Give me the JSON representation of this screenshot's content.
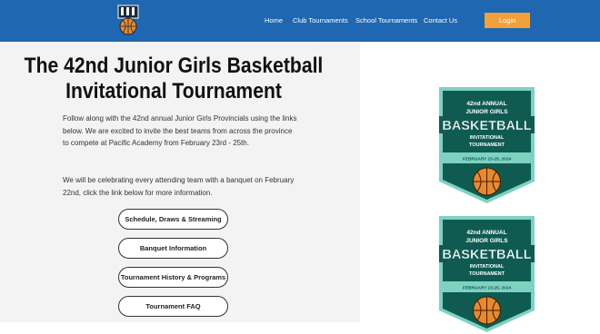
{
  "header": {
    "nav": [
      "Home",
      "Club Tournaments",
      "School Tournaments",
      "Contact Us"
    ],
    "login_label": "Login"
  },
  "main": {
    "title_line1": "The 42nd Junior Girls Basketball",
    "title_line2": "Invitational Tournament",
    "paragraph1": "Follow along with the 42nd annual Junior Girls Provincials using the links below. We are excited to invite the best teams from across the province to compete at Pacific Academy from February 23rd - 25th.",
    "paragraph2": "We will be celebrating every attending team with a banquet on February 22nd, click the link below for more information.",
    "buttons": [
      "Schedule, Draws & Streaming",
      "Banquet Information",
      "Tournament History & Programs",
      "Tournament FAQ"
    ]
  },
  "badge": {
    "line1": "42nd ANNUAL",
    "line2": "JUNIOR GIRLS",
    "line3": "BASKETBALL",
    "line4": "INVITATIONAL",
    "line5": "TOURNAMENT",
    "dates": "FEBRUARY 23-25, 2024"
  },
  "colors": {
    "header": "#1f67b0",
    "login": "#f2a13a",
    "badge_dark": "#0f5b52",
    "badge_light": "#7fd2c2",
    "ball": "#e8892b"
  }
}
